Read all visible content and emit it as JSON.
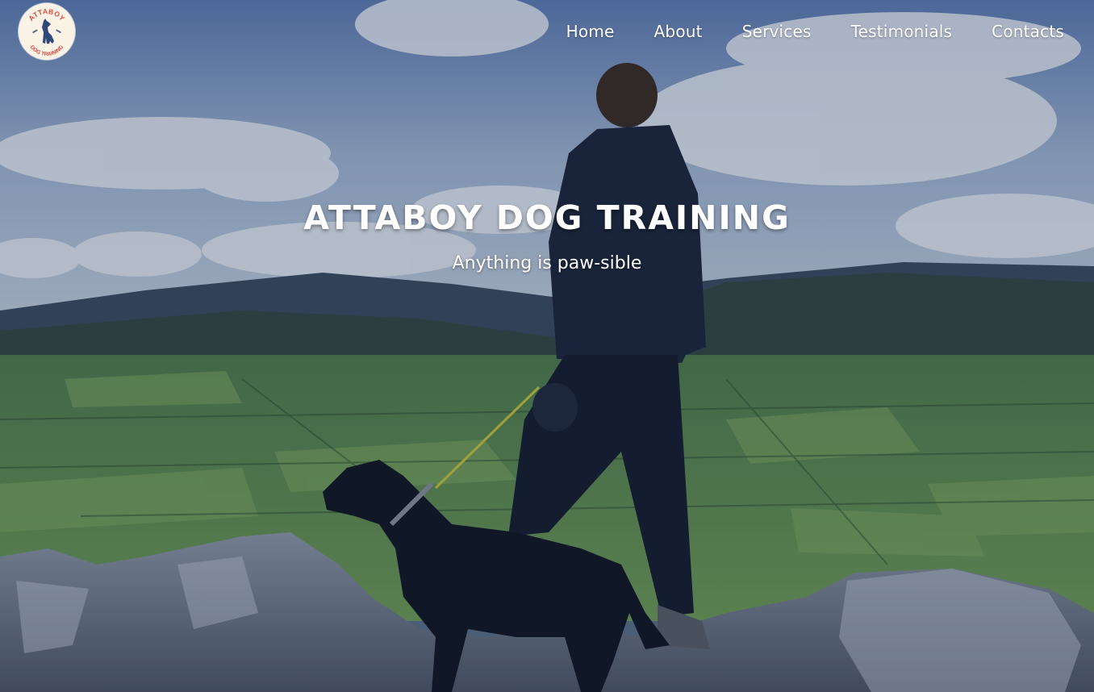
{
  "brand": {
    "logo_top_text": "ATTABOY",
    "logo_bottom_text": "DOG TRAINING"
  },
  "nav": {
    "items": [
      {
        "label": "Home"
      },
      {
        "label": "About"
      },
      {
        "label": "Services"
      },
      {
        "label": "Testimonials"
      },
      {
        "label": "Contacts"
      }
    ]
  },
  "hero": {
    "title": "ATTABOY DOG TRAINING",
    "subtitle": "Anything is paw-sible"
  },
  "colors": {
    "logo_accent": "#e0463d",
    "logo_dog": "#2f4a7a",
    "logo_background": "#fbf3e6",
    "text": "#ffffff"
  },
  "icons": {
    "logo": "dog-silhouette-icon"
  }
}
